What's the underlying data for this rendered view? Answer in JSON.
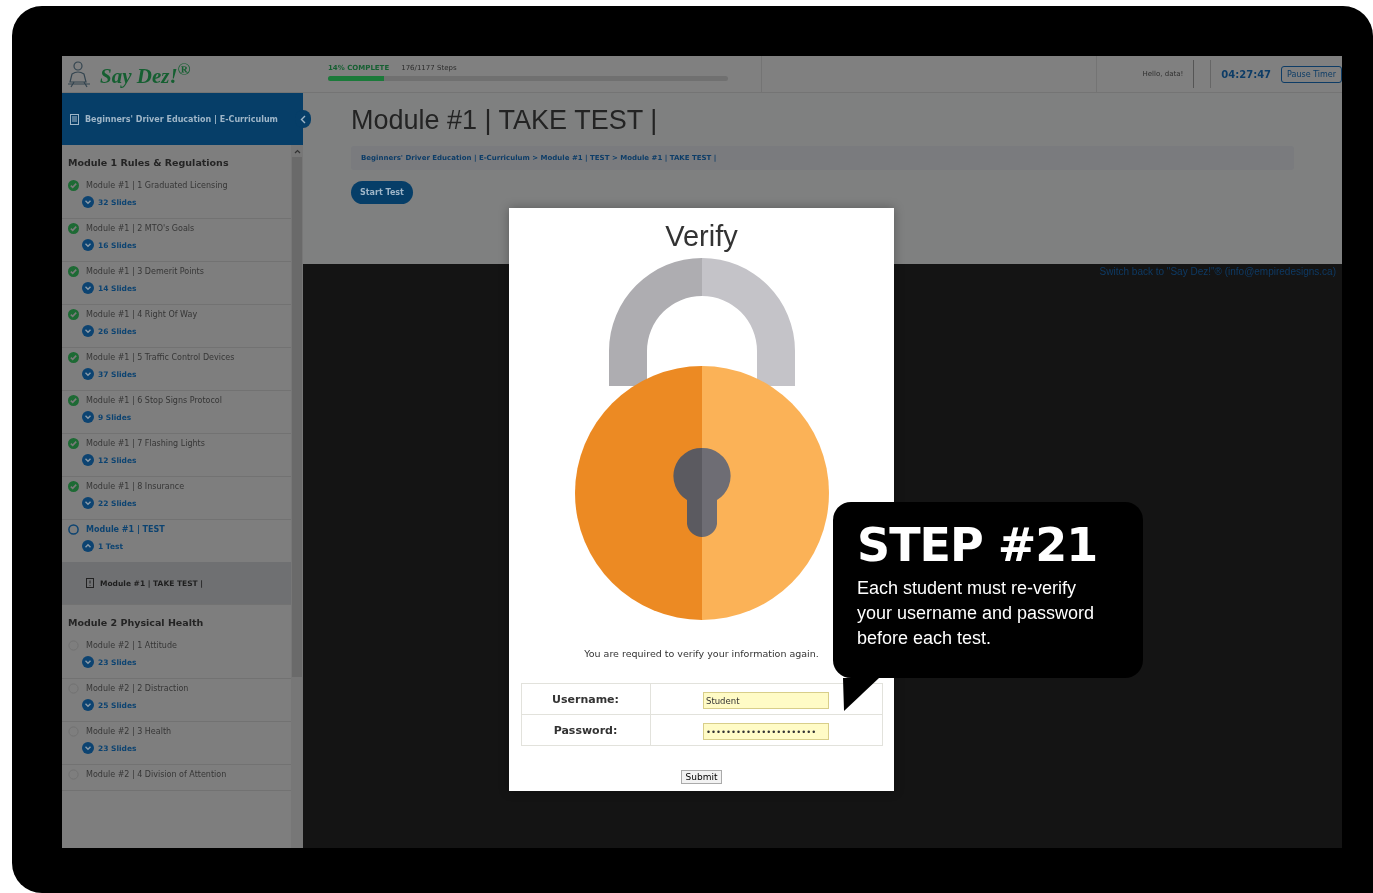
{
  "header": {
    "logo": "Say Dez!$^{®}$",
    "progress": {
      "label": "14% COMPLETE",
      "steps": "176/1177 Steps",
      "level": 0.14
    },
    "greeting": "Hello, data!",
    "timer": "04:27:47",
    "pause_button": "Pause Timer"
  },
  "sidebar": {
    "title": "Beginners' Driver Education | E-Curriculum",
    "sections": [
      {
        "title": "Module 1 Rules & Regulations",
        "items": [
          {
            "label": "Module #1 | 1 Graduated Licensing",
            "count": "32 Slides",
            "completed": true,
            "selected": false,
            "expanded": false
          },
          {
            "label": "Module #1 | 2 MTO's Goals",
            "count": "16 Slides",
            "completed": true,
            "selected": false,
            "expanded": false
          },
          {
            "label": "Module #1 | 3 Demerit Points",
            "count": "14 Slides",
            "completed": true,
            "selected": false,
            "expanded": false
          },
          {
            "label": "Module #1 | 4 Right Of Way",
            "count": "26 Slides",
            "completed": true,
            "selected": false,
            "expanded": false
          },
          {
            "label": "Module #1 | 5 Traffic Control Devices",
            "count": "37 Slides",
            "completed": true,
            "selected": false,
            "expanded": false
          },
          {
            "label": "Module #1 | 6 Stop Signs Protocol",
            "count": "9 Slides",
            "completed": true,
            "selected": false,
            "expanded": false
          },
          {
            "label": "Module #1 | 7 Flashing Lights",
            "count": "12 Slides",
            "completed": true,
            "selected": false,
            "expanded": false
          },
          {
            "label": "Module #1 | 8 Insurance",
            "count": "22 Slides",
            "completed": true,
            "selected": false,
            "expanded": false
          },
          {
            "label": "Module #1 | TEST",
            "count": "1 Test",
            "completed": false,
            "selected": true,
            "expanded": true,
            "children": [
              {
                "label": "Module #1 | TAKE TEST |",
                "selected": true
              }
            ]
          }
        ]
      },
      {
        "title": "Module 2 Physical Health",
        "items": [
          {
            "label": "Module #2 | 1 Attitude",
            "count": "23 Slides",
            "completed": false,
            "selected": false,
            "expanded": false
          },
          {
            "label": "Module #2 | 2 Distraction",
            "count": "25 Slides",
            "completed": false,
            "selected": false,
            "expanded": false
          },
          {
            "label": "Module #2 | 3 Health",
            "count": "23 Slides",
            "completed": false,
            "selected": false,
            "expanded": false
          },
          {
            "label": "Module #2 | 4 Division of Attention",
            "completed": false,
            "selected": false,
            "expanded": false
          }
        ]
      }
    ]
  },
  "main": {
    "heading": "Module #1 | TAKE TEST |",
    "breadcrumb": "Beginners' Driver Education | E-Curriculum > Module #1 | TEST > Module #1 | TAKE TEST |",
    "start_button": "Start Test",
    "footer_link": "Switch back to \"Say Dez!\"® (info@empiredesigns.ca)"
  },
  "dialog": {
    "title": "Verify",
    "message": "You are required to verify your information again.",
    "fields": [
      {
        "label": "Username:",
        "value": "Student"
      },
      {
        "label": "Password:",
        "value": "••••••••••••••••••••••"
      }
    ],
    "submit": "Submit"
  },
  "callout": {
    "title": "STEP #21",
    "text": "Each student must re-verify your username and password before each test."
  }
}
